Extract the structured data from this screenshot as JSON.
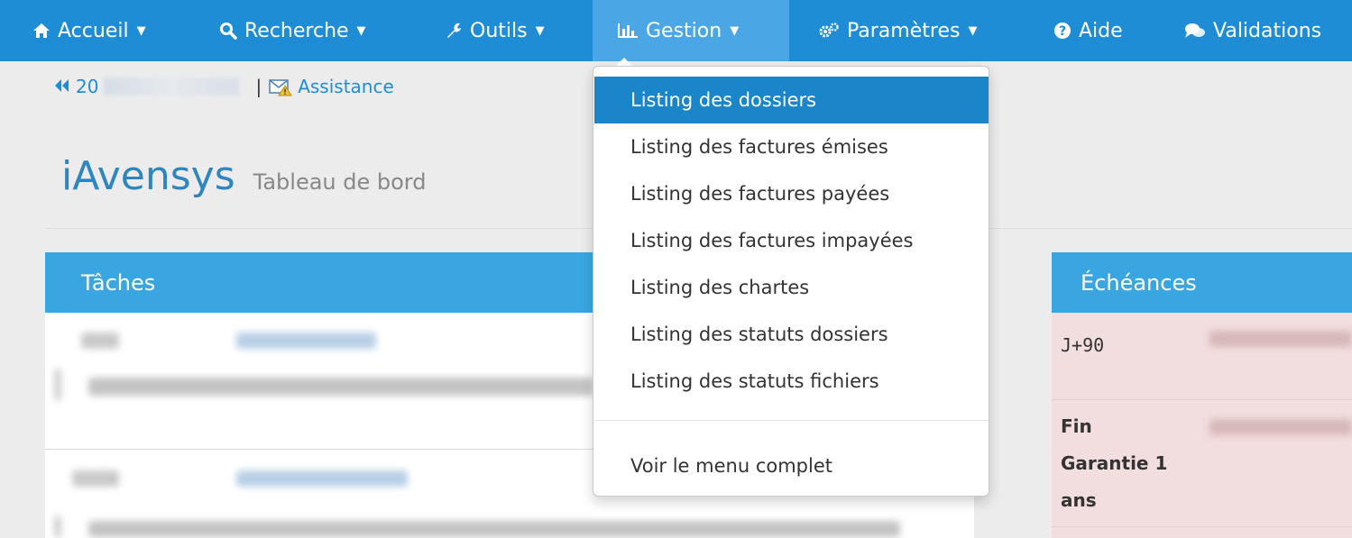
{
  "nav": {
    "items": [
      {
        "label": "Accueil",
        "icon": "home-icon"
      },
      {
        "label": "Recherche",
        "icon": "search-icon"
      },
      {
        "label": "Outils",
        "icon": "wrench-icon"
      },
      {
        "label": "Gestion",
        "icon": "bar-chart-icon"
      },
      {
        "label": "Paramètres",
        "icon": "gears-icon"
      },
      {
        "label": "Aide",
        "icon": "question-circle-icon"
      },
      {
        "label": "Validations",
        "icon": "chat-bubbles-icon"
      }
    ]
  },
  "breadcrumb": {
    "back_prefix": "20",
    "separator": "|",
    "assistance_label": "Assistance"
  },
  "page": {
    "app_name": "iAvensys",
    "subtitle": "Tableau de bord"
  },
  "panels": {
    "tasks_title": "Tâches",
    "echeances_title": "Échéances",
    "echeances_rows": [
      {
        "label": "J+90"
      },
      {
        "label": "Fin Garantie 1 ans"
      }
    ]
  },
  "gestion_menu": {
    "items": [
      "Listing des dossiers",
      "Listing des factures émises",
      "Listing des factures payées",
      "Listing des factures impayées",
      "Listing des chartes",
      "Listing des statuts dossiers",
      "Listing des statuts fichiers"
    ],
    "footer_item": "Voir le menu complet",
    "selected_index": 0
  },
  "colors": {
    "navbar": "#1f8dd6",
    "navbar_active": "#4aa6e4",
    "panel_header": "#3aa6e1",
    "selected_item": "#1a85c9",
    "echeance_bg": "#f2dede"
  }
}
